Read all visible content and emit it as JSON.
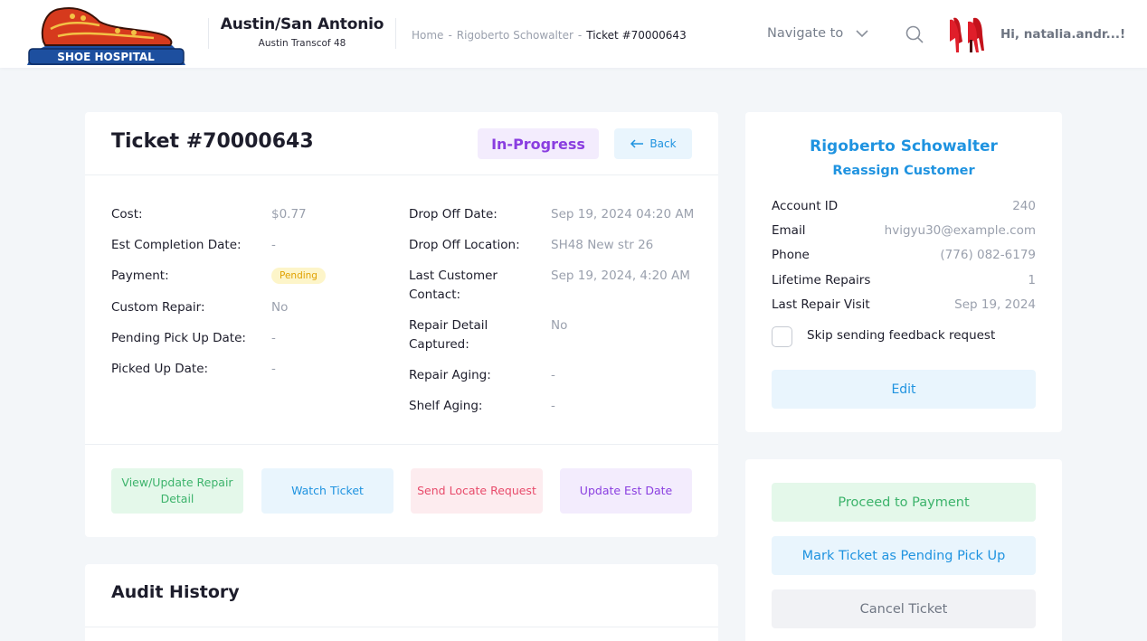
{
  "header": {
    "logo_text": "SHOE HOSPITAL",
    "store_name": "Austin/San Antonio",
    "store_sub": "Austin Transcof 48",
    "breadcrumb": [
      "Home",
      "Rigoberto Schowalter",
      "Ticket #70000643"
    ],
    "breadcrumb_sep": "-",
    "navigate_label": "Navigate to",
    "greeting": "Hi, natalia.andr...!"
  },
  "ticket": {
    "title": "Ticket #70000643",
    "status": "In-Progress",
    "back_label": "Back",
    "left_fields": [
      {
        "label": "Cost:",
        "value": "$0.77"
      },
      {
        "label": "Est Completion Date:",
        "value": "-"
      },
      {
        "label": "Payment:",
        "value": "Pending"
      },
      {
        "label": "Custom Repair:",
        "value": "No"
      },
      {
        "label": "Pending Pick Up Date:",
        "value": "-"
      },
      {
        "label": "Picked Up Date:",
        "value": "-"
      }
    ],
    "right_fields": [
      {
        "label": "Drop Off Date:",
        "value": "Sep 19, 2024 04:20 AM"
      },
      {
        "label": "Drop Off Location:",
        "value": "SH48 New str 26"
      },
      {
        "label": "Last Customer Contact:",
        "value": "Sep 19, 2024, 4:20 AM"
      },
      {
        "label": "Repair Detail Captured:",
        "value": "No"
      },
      {
        "label": "Repair Aging:",
        "value": "-"
      },
      {
        "label": "Shelf Aging:",
        "value": "-"
      }
    ],
    "actions": [
      "View/Update Repair Detail",
      "Watch Ticket",
      "Send Locate Request",
      "Update Est Date"
    ]
  },
  "audit": {
    "title": "Audit History"
  },
  "customer": {
    "name": "Rigoberto Schowalter",
    "reassign_label": "Reassign Customer",
    "info": [
      {
        "label": "Account ID",
        "value": "240"
      },
      {
        "label": "Email",
        "value": "hvigyu30@example.com"
      },
      {
        "label": "Phone",
        "value": "(776) 082-6179"
      },
      {
        "label": "Lifetime Repairs",
        "value": "1"
      },
      {
        "label": "Last Repair Visit",
        "value": "Sep 19, 2024"
      }
    ],
    "skip_feedback_label": "Skip sending feedback request",
    "skip_feedback_checked": false,
    "edit_label": "Edit"
  },
  "side_actions": {
    "payment_label": "Proceed to Payment",
    "pending_pickup_label": "Mark Ticket as Pending Pick Up",
    "cancel_label": "Cancel Ticket"
  },
  "colors": {
    "accent_blue": "#1f93e0",
    "status_purple": "#8a3ee0",
    "success_green": "#3cb36b",
    "danger_red": "#e84b6b",
    "pending_yellow": "#e0a100"
  }
}
